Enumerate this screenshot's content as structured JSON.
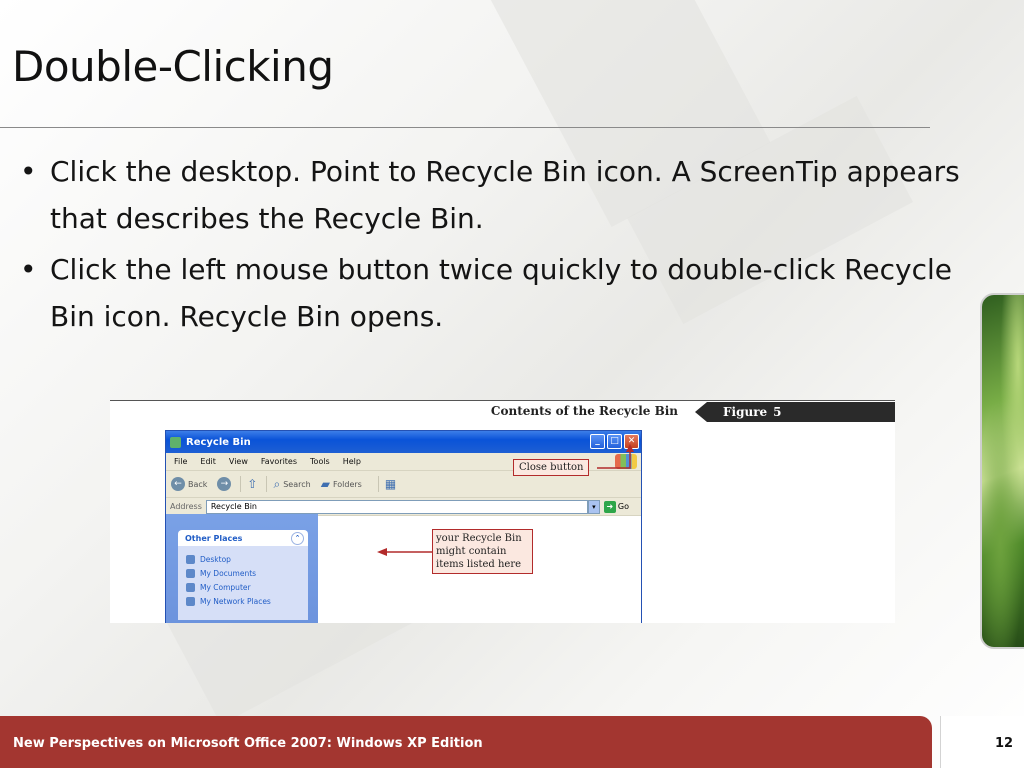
{
  "slide": {
    "title": "Double-Clicking",
    "bullets": [
      "Click the desktop. Point to Recycle Bin icon.  A ScreenTip appears that describes the Recycle Bin.",
      "Click the left mouse button twice quickly to double-click Recycle Bin icon. Recycle Bin opens."
    ],
    "bullet_glyph": "•"
  },
  "figure": {
    "caption": "Contents of the Recycle Bin",
    "tag_word": "Figure",
    "tag_number": "5",
    "window": {
      "title": "Recycle Bin",
      "menus": [
        "File",
        "Edit",
        "View",
        "Favorites",
        "Tools",
        "Help"
      ],
      "toolbar": {
        "back": "Back",
        "search": "Search",
        "folders": "Folders"
      },
      "address_label": "Address",
      "address_value": "Recycle Bin",
      "go": "Go",
      "other_places": {
        "heading": "Other Places",
        "items": [
          "Desktop",
          "My Documents",
          "My Computer",
          "My Network Places"
        ]
      }
    },
    "callouts": {
      "close_button": "Close button",
      "recycle_bin_lines": [
        "your Recycle Bin",
        "might contain",
        "items listed here"
      ]
    }
  },
  "footer": {
    "text": "New Perspectives on Microsoft Office 2007: Windows XP Edition",
    "page_number": "12"
  },
  "colors": {
    "footer_bg": "#a33630",
    "xp_title_blue": "#0a53d8",
    "callout_border": "#b22b2b"
  }
}
